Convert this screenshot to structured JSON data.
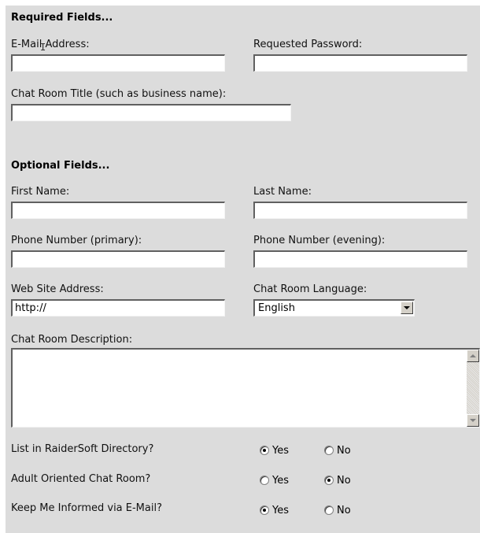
{
  "required": {
    "title": "Required Fields...",
    "email": {
      "label": "E-Mail Address:",
      "value": ""
    },
    "password": {
      "label": "Requested Password:",
      "value": ""
    },
    "room_title": {
      "label": "Chat Room Title (such as business name):",
      "value": ""
    }
  },
  "optional": {
    "title": "Optional Fields...",
    "first_name": {
      "label": "First Name:",
      "value": ""
    },
    "last_name": {
      "label": "Last Name:",
      "value": ""
    },
    "phone_primary": {
      "label": "Phone Number (primary):",
      "value": ""
    },
    "phone_evening": {
      "label": "Phone Number (evening):",
      "value": ""
    },
    "website": {
      "label": "Web Site Address:",
      "value": "http://"
    },
    "language": {
      "label": "Chat Room Language:",
      "selected": "English"
    },
    "description": {
      "label": "Chat Room Description:",
      "value": ""
    }
  },
  "options": [
    {
      "label": "List in RaiderSoft Directory?",
      "yes": "Yes",
      "no": "No",
      "selected": "yes"
    },
    {
      "label": "Adult Oriented Chat Room?",
      "yes": "Yes",
      "no": "No",
      "selected": "no"
    },
    {
      "label": "Keep Me Informed via E-Mail?",
      "yes": "Yes",
      "no": "No",
      "selected": "yes"
    }
  ],
  "icons": {
    "cursor": "text-cursor-icon",
    "dropdown": "chevron-down-icon"
  },
  "colors": {
    "panel": "#dcdcdc"
  }
}
